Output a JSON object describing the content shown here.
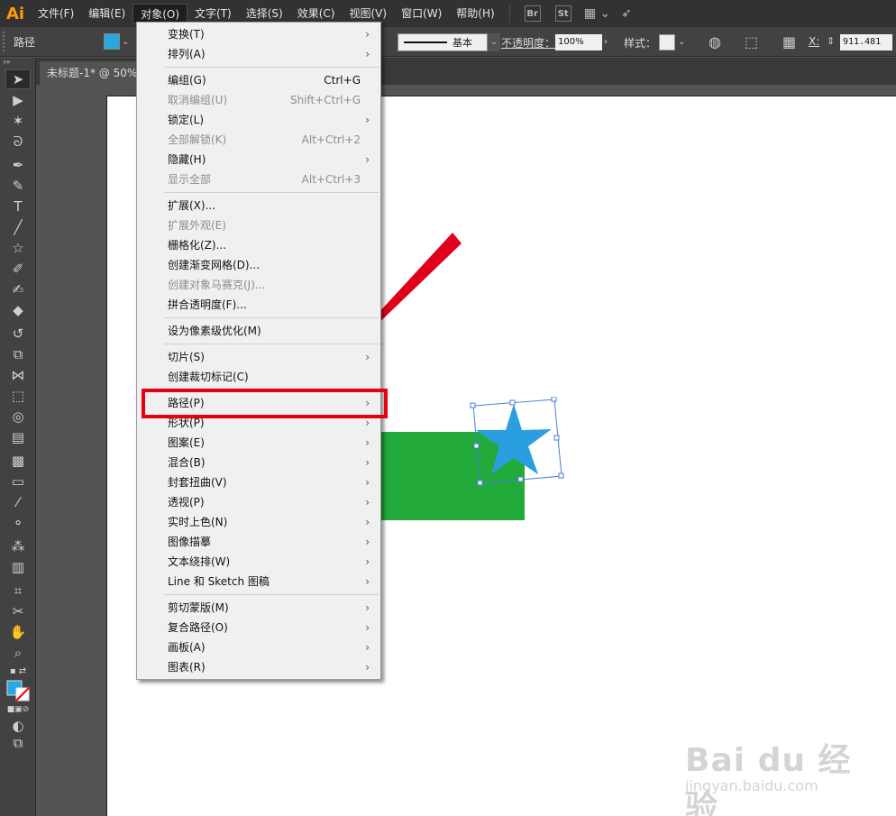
{
  "app": {
    "logo": "Ai"
  },
  "menubar": {
    "items": [
      "文件(F)",
      "编辑(E)",
      "对象(O)",
      "文字(T)",
      "选择(S)",
      "效果(C)",
      "视图(V)",
      "窗口(W)",
      "帮助(H)"
    ],
    "active_index": 2,
    "badges": [
      "Br",
      "St"
    ]
  },
  "controlbar": {
    "selection_label": "路径",
    "fill_color": "#29a8e0",
    "stroke_profile_label": "基本",
    "opacity_label": "不透明度：",
    "opacity_value": "100%",
    "style_label": "样式：",
    "x_label": "X:",
    "x_value": "911.481"
  },
  "document": {
    "tab_label": "未标题-1* @ 50%"
  },
  "canvas": {
    "rect_color": "#22aa3a",
    "star_color": "#29a8e0"
  },
  "object_menu": {
    "items": [
      {
        "label": "变换(T)",
        "shortcut": "",
        "submenu": true,
        "disabled": false
      },
      {
        "label": "排列(A)",
        "shortcut": "",
        "submenu": true,
        "disabled": false
      },
      {
        "sep": true
      },
      {
        "label": "编组(G)",
        "shortcut": "Ctrl+G",
        "submenu": false,
        "disabled": false
      },
      {
        "label": "取消编组(U)",
        "shortcut": "Shift+Ctrl+G",
        "submenu": false,
        "disabled": true
      },
      {
        "label": "锁定(L)",
        "shortcut": "",
        "submenu": true,
        "disabled": false
      },
      {
        "label": "全部解锁(K)",
        "shortcut": "Alt+Ctrl+2",
        "submenu": false,
        "disabled": true
      },
      {
        "label": "隐藏(H)",
        "shortcut": "",
        "submenu": true,
        "disabled": false
      },
      {
        "label": "显示全部",
        "shortcut": "Alt+Ctrl+3",
        "submenu": false,
        "disabled": true
      },
      {
        "sep": true
      },
      {
        "label": "扩展(X)...",
        "shortcut": "",
        "submenu": false,
        "disabled": false
      },
      {
        "label": "扩展外观(E)",
        "shortcut": "",
        "submenu": false,
        "disabled": true
      },
      {
        "label": "栅格化(Z)...",
        "shortcut": "",
        "submenu": false,
        "disabled": false
      },
      {
        "label": "创建渐变网格(D)...",
        "shortcut": "",
        "submenu": false,
        "disabled": false
      },
      {
        "label": "创建对象马赛克(J)...",
        "shortcut": "",
        "submenu": false,
        "disabled": true
      },
      {
        "label": "拼合透明度(F)...",
        "shortcut": "",
        "submenu": false,
        "disabled": false
      },
      {
        "sep": true
      },
      {
        "label": "设为像素级优化(M)",
        "shortcut": "",
        "submenu": false,
        "disabled": false
      },
      {
        "sep": true
      },
      {
        "label": "切片(S)",
        "shortcut": "",
        "submenu": true,
        "disabled": false
      },
      {
        "label": "创建裁切标记(C)",
        "shortcut": "",
        "submenu": false,
        "disabled": false
      },
      {
        "sep": true
      },
      {
        "label": "路径(P)",
        "shortcut": "",
        "submenu": true,
        "disabled": false
      },
      {
        "label": "形状(P)",
        "shortcut": "",
        "submenu": true,
        "disabled": false
      },
      {
        "label": "图案(E)",
        "shortcut": "",
        "submenu": true,
        "disabled": false
      },
      {
        "label": "混合(B)",
        "shortcut": "",
        "submenu": true,
        "disabled": false
      },
      {
        "label": "封套扭曲(V)",
        "shortcut": "",
        "submenu": true,
        "disabled": false
      },
      {
        "label": "透视(P)",
        "shortcut": "",
        "submenu": true,
        "disabled": false
      },
      {
        "label": "实时上色(N)",
        "shortcut": "",
        "submenu": true,
        "disabled": false
      },
      {
        "label": "图像描摹",
        "shortcut": "",
        "submenu": true,
        "disabled": false
      },
      {
        "label": "文本绕排(W)",
        "shortcut": "",
        "submenu": true,
        "disabled": false
      },
      {
        "label": "Line 和 Sketch 图稿",
        "shortcut": "",
        "submenu": true,
        "disabled": false
      },
      {
        "sep": true
      },
      {
        "label": "剪切蒙版(M)",
        "shortcut": "",
        "submenu": true,
        "disabled": false
      },
      {
        "label": "复合路径(O)",
        "shortcut": "",
        "submenu": true,
        "disabled": false
      },
      {
        "label": "画板(A)",
        "shortcut": "",
        "submenu": true,
        "disabled": false
      },
      {
        "label": "图表(R)",
        "shortcut": "",
        "submenu": true,
        "disabled": false
      }
    ],
    "submenu_arrow": "›"
  },
  "annotation": {
    "highlight_color": "#e50012",
    "arrow_color": "#e0001b"
  },
  "watermark": {
    "main": "Bai du 经验",
    "sub": "jingyan.baidu.com"
  },
  "tools": [
    "selection-tool-icon",
    "direct-selection-tool-icon",
    "magic-wand-tool-icon",
    "lasso-tool-icon",
    "pen-tool-icon",
    "curvature-tool-icon",
    "type-tool-icon",
    "line-segment-tool-icon",
    "star-tool-icon",
    "paintbrush-tool-icon",
    "blob-brush-tool-icon",
    "eraser-tool-icon",
    "rotate-tool-icon",
    "scale-tool-icon",
    "width-tool-icon",
    "free-transform-tool-icon",
    "shape-builder-tool-icon",
    "perspective-grid-tool-icon",
    "mesh-tool-icon",
    "gradient-tool-icon",
    "eyedropper-tool-icon",
    "blend-tool-icon",
    "symbol-sprayer-tool-icon",
    "column-graph-tool-icon",
    "artboard-tool-icon",
    "slice-tool-icon",
    "hand-tool-icon",
    "zoom-tool-icon"
  ]
}
